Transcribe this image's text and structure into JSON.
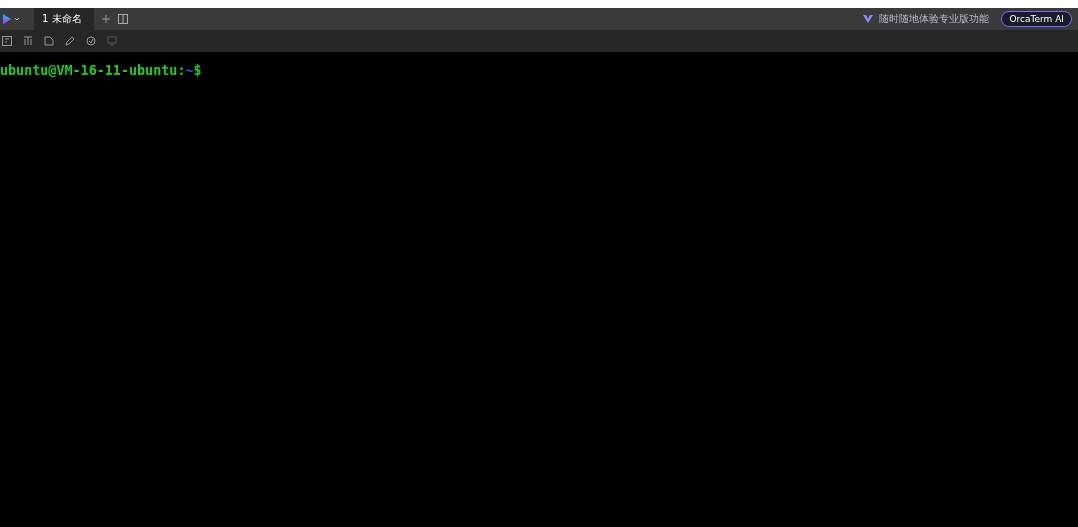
{
  "tabs": [
    {
      "number": "1",
      "label": "未命名",
      "selected": true
    }
  ],
  "promo": {
    "text": "随时随地体验专业版功能"
  },
  "ai_button": {
    "label": "OrcaTerm AI"
  },
  "terminal": {
    "user_host": "ubuntu@VM-16-11-ubuntu",
    "separator": ":",
    "path": "~",
    "prompt": "$"
  }
}
